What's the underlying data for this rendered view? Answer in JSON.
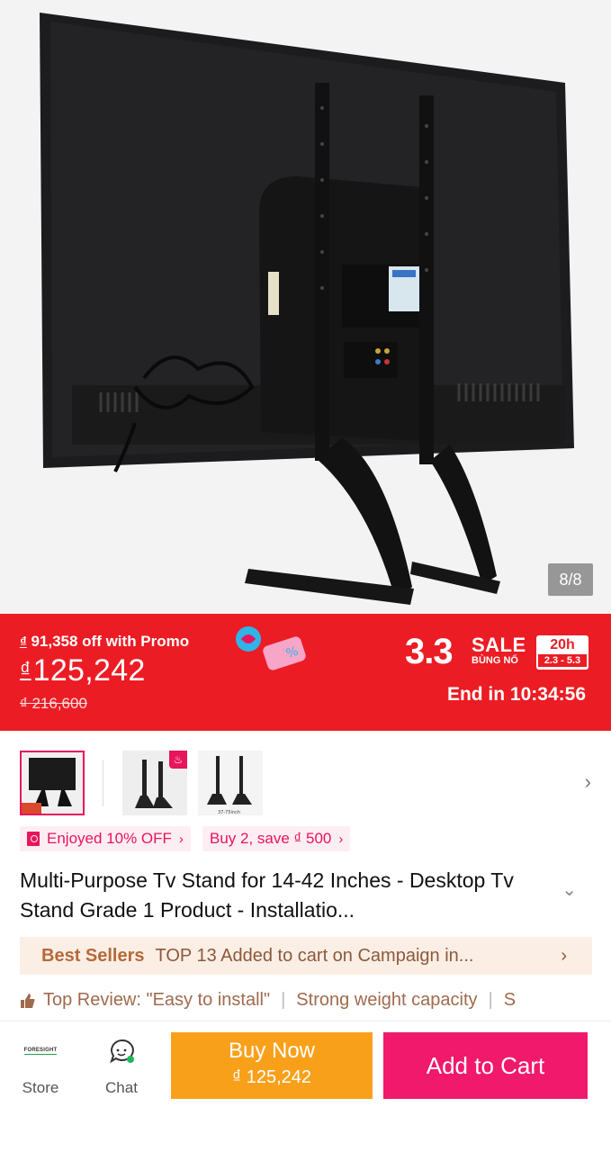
{
  "gallery": {
    "counter": "8/8",
    "main_image": "tv-stand-back-view",
    "thumbnails": [
      {
        "name": "tv-stand-front-thumb",
        "active": true
      },
      {
        "name": "tv-stand-brackets-thumb",
        "active": false,
        "hot": true
      },
      {
        "name": "tv-stand-legs-thumb",
        "active": false,
        "caption": "37-75inch"
      }
    ]
  },
  "promo": {
    "off_text": "91,358 off with Promo",
    "currency": "₫",
    "price": "125,242",
    "original_price": "₫ 216,600",
    "sale_number": "3.3",
    "sale_word": "SALE",
    "sale_sub": "BÙNG NỔ",
    "sale_hours": "20h",
    "sale_dates": "2.3 - 5.3",
    "countdown": "End in 10:34:56",
    "bg_color": "#ec1c24"
  },
  "coupons": [
    {
      "label": "Enjoyed 10% OFF"
    },
    {
      "label": "Buy 2, save ₫ 500"
    }
  ],
  "product": {
    "title": "Multi-Purpose Tv Stand for 14-42 Inches - Desktop Tv Stand Grade 1 Product - Installatio..."
  },
  "best_sellers": {
    "label": "Best Sellers",
    "text": "TOP 13 Added to cart on Campaign in..."
  },
  "reviews": {
    "top": "Top Review: \"Easy to install\"",
    "second": "Strong weight capacity",
    "third": "S"
  },
  "bottom_bar": {
    "store_logo": "FORESIGHT",
    "store_label": "Store",
    "chat_label": "Chat",
    "buy_now_label": "Buy Now",
    "buy_now_price": "₫ 125,242",
    "add_to_cart_label": "Add to Cart",
    "buy_now_color": "#f9a01b",
    "add_to_cart_color": "#f0196c"
  }
}
